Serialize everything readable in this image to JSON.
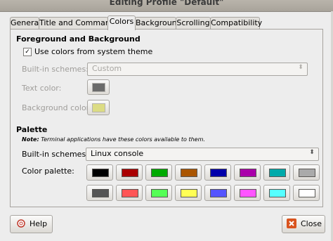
{
  "window": {
    "title": "Editing Profile \"Default\""
  },
  "tabs": [
    {
      "label": "General",
      "active": false
    },
    {
      "label": "Title and Command",
      "active": false
    },
    {
      "label": "Colors",
      "active": true
    },
    {
      "label": "Background",
      "active": false
    },
    {
      "label": "Scrolling",
      "active": false
    },
    {
      "label": "Compatibility",
      "active": false
    }
  ],
  "foreground_background": {
    "heading": "Foreground and Background",
    "use_system_theme_label": "Use colors from system theme",
    "use_system_theme_checked": true,
    "builtin_schemes_label": "Built-in schemes:",
    "builtin_schemes_value": "Custom",
    "text_color_label": "Text color:",
    "text_color": "#6b6b6b",
    "background_color_label": "Background color:",
    "background_color": "#dcdc84"
  },
  "palette": {
    "heading": "Palette",
    "note_prefix": "Note:",
    "note_text": "Terminal applications have these colors available to them.",
    "builtin_schemes_label": "Built-in schemes:",
    "builtin_schemes_value": "Linux console",
    "color_palette_label": "Color palette:",
    "colors": [
      "#000000",
      "#aa0000",
      "#00aa00",
      "#aa5500",
      "#0000aa",
      "#aa00aa",
      "#00aaaa",
      "#aaaaaa",
      "#555555",
      "#ff5555",
      "#55ff55",
      "#ffff55",
      "#5555ff",
      "#ff55ff",
      "#55ffff",
      "#ffffff"
    ]
  },
  "buttons": {
    "help_label": "Help",
    "close_label": "Close",
    "close_icon_color": "#d9531e"
  }
}
